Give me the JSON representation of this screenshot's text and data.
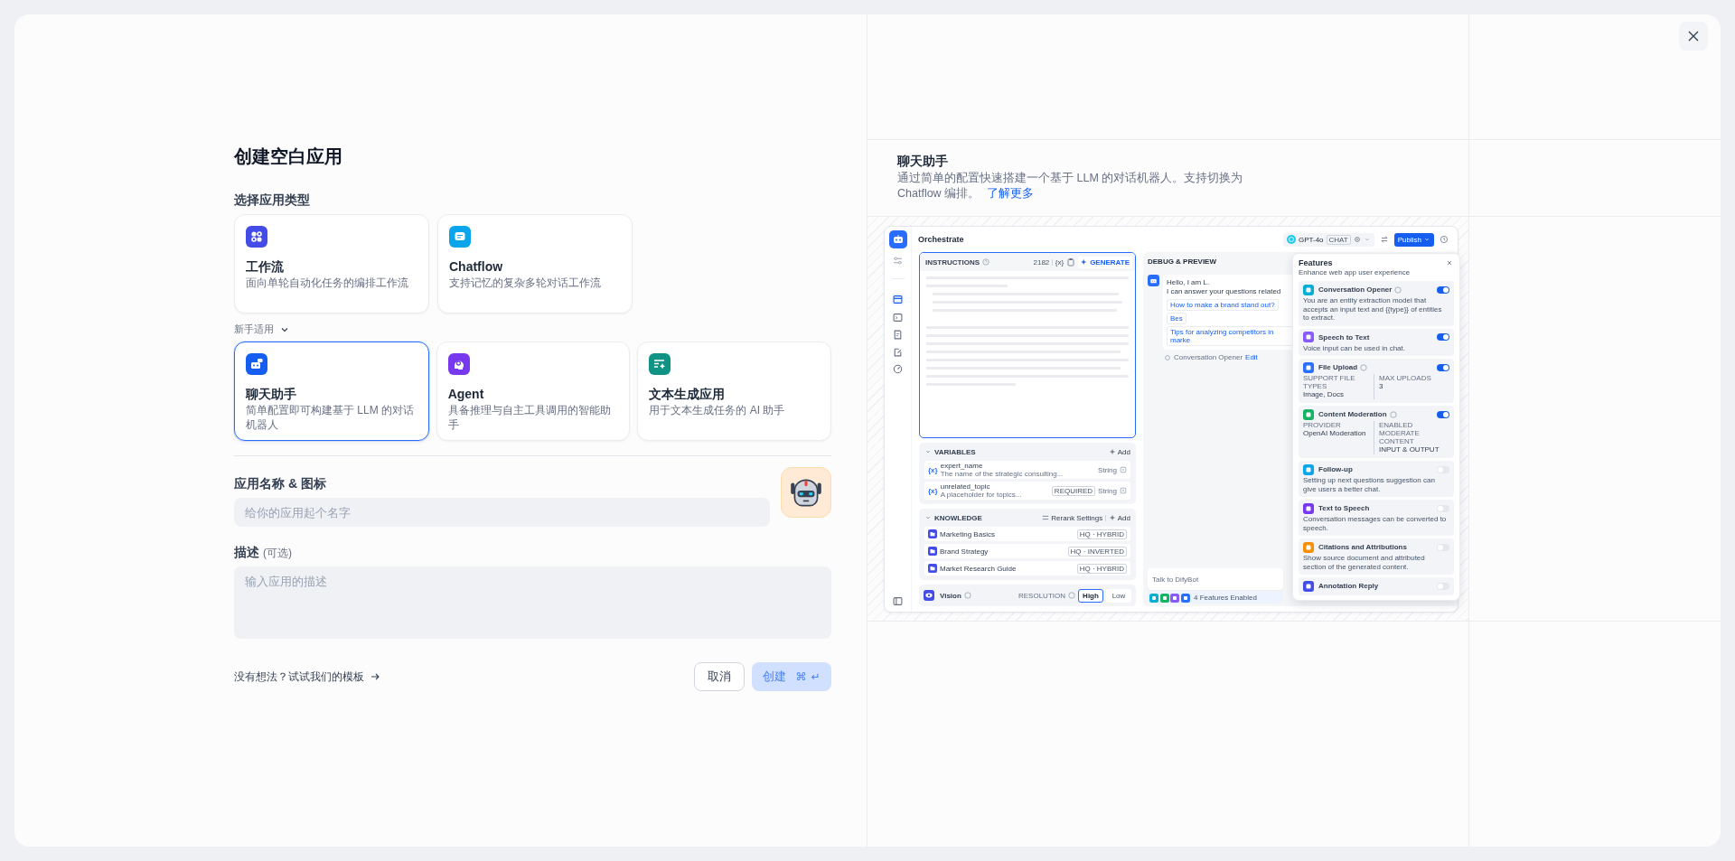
{
  "left": {
    "title": "创建空白应用",
    "type_label": "选择应用类型",
    "advanced_types": [
      {
        "kind": "workflow",
        "name": "工作流",
        "desc": "面向单轮自动化任务的编排工作流",
        "selected": false
      },
      {
        "kind": "chatflow",
        "name": "Chatflow",
        "desc": "支持记忆的复杂多轮对话工作流",
        "selected": false
      }
    ],
    "beginner_toggle": {
      "label": "新手适用",
      "expanded": true
    },
    "beginner_types": [
      {
        "kind": "chat",
        "name": "聊天助手",
        "desc": "简单配置即可构建基于 LLM 的对话机器人",
        "selected": true
      },
      {
        "kind": "agent",
        "name": "Agent",
        "desc": "具备推理与自主工具调用的智能助手",
        "selected": false
      },
      {
        "kind": "completion",
        "name": "文本生成应用",
        "desc": "用于文本生成任务的 AI 助手",
        "selected": false
      }
    ],
    "name_field": {
      "label": "应用名称 & 图标",
      "placeholder": "给你的应用起个名字"
    },
    "description_field": {
      "label": "描述",
      "optional": "(可选)",
      "placeholder": "输入应用的描述"
    },
    "template_link": "没有想法？试试我们的模板",
    "cancel": "取消",
    "create": {
      "label": "创建",
      "keys": [
        "⌘",
        "↵"
      ],
      "disabled": true
    }
  },
  "info": {
    "title": "聊天助手",
    "desc": "通过简单的配置快速搭建一个基于 LLM 的对话机器人。支持切换为 Chatflow 编排。",
    "link": "了解更多"
  },
  "preview": {
    "header": {
      "title": "Orchestrate",
      "model": "GPT-4o",
      "model_badge": "CHAT",
      "publish": "Publish"
    },
    "instructions": {
      "label": "INSTRUCTIONS",
      "count": "2182",
      "var_button": "{x}",
      "generate": "GENERATE"
    },
    "variables": {
      "label": "VARIABLES",
      "add": "Add",
      "items": [
        {
          "icon_text": "{x}",
          "name": "expert_name",
          "desc": "The name of the strategic consulting...",
          "required": false,
          "type": "String"
        },
        {
          "icon_text": "{x}",
          "name": "unrelated_topic",
          "desc": "A placeholder for topics...",
          "required": true,
          "required_label": "REQUIRED",
          "type": "String"
        }
      ]
    },
    "knowledge": {
      "label": "KNOWLEDGE",
      "rerank": "Rerank Settings",
      "add": "Add",
      "items": [
        {
          "name": "Marketing Basics",
          "tag": "HQ · HYBRID"
        },
        {
          "name": "Brand Strategy",
          "tag": "HQ · INVERTED"
        },
        {
          "name": "Market Research Guide",
          "tag": "HQ · HYBRID"
        }
      ]
    },
    "vision": {
      "label": "Vision",
      "resolution_label": "RESOLUTION",
      "options": [
        {
          "label": "High",
          "selected": true
        },
        {
          "label": "Low",
          "selected": false
        }
      ]
    },
    "debug": {
      "title": "DEBUG & PREVIEW",
      "greeting": [
        "Hello, I am L.",
        "I can answer your questions related"
      ],
      "suggestions": [
        "How to make a brand stand out?",
        "Bes",
        "Tips for analyzing competitors in marke"
      ],
      "opener_label": "Conversation Opener",
      "edit": "Edit",
      "input_placeholder": "Talk to DifyBot",
      "features_enabled": "4 Features Enabled"
    },
    "features": {
      "title": "Features",
      "subtitle": "Enhance web app user experience",
      "items": [
        {
          "kind": "text",
          "name": "Conversation Opener",
          "help": true,
          "on": true,
          "color": "#06aed4",
          "desc": "You are an entity extraction model that accepts an input text and {{type}} of entities to extract."
        },
        {
          "kind": "text",
          "name": "Speech to Text",
          "help": false,
          "on": true,
          "color": "#875bf7",
          "desc": "Voice input can be used in chat."
        },
        {
          "kind": "fields",
          "name": "File Upload",
          "help": true,
          "on": true,
          "color": "#2970ff",
          "fields": [
            {
              "label": "SUPPORT FILE TYPES",
              "value": "Image, Docs"
            },
            {
              "label": "MAX UPLOADS",
              "value": "3"
            }
          ]
        },
        {
          "kind": "fields",
          "name": "Content Moderation",
          "help": true,
          "on": true,
          "color": "#16b364",
          "fields": [
            {
              "label": "PROVIDER",
              "value": "OpenAI Moderation"
            },
            {
              "label": "ENABLED MODERATE CONTENT",
              "value": "INPUT & OUTPUT"
            }
          ]
        },
        {
          "kind": "text",
          "name": "Follow-up",
          "help": false,
          "on": false,
          "color": "#0ba5ec",
          "desc": "Setting up next questions suggestion can give users a better chat."
        },
        {
          "kind": "text",
          "name": "Text to Speech",
          "help": false,
          "on": false,
          "color": "#7839ee",
          "desc": "Conversation messages can be converted to speech."
        },
        {
          "kind": "text",
          "name": "Citations and Attributions",
          "help": false,
          "on": false,
          "color": "#f79009",
          "desc": "Show source document and attributed section of the generated content."
        },
        {
          "kind": "text",
          "name": "Annotation Reply",
          "help": false,
          "on": false,
          "color": "#444ce7"
        }
      ]
    }
  }
}
